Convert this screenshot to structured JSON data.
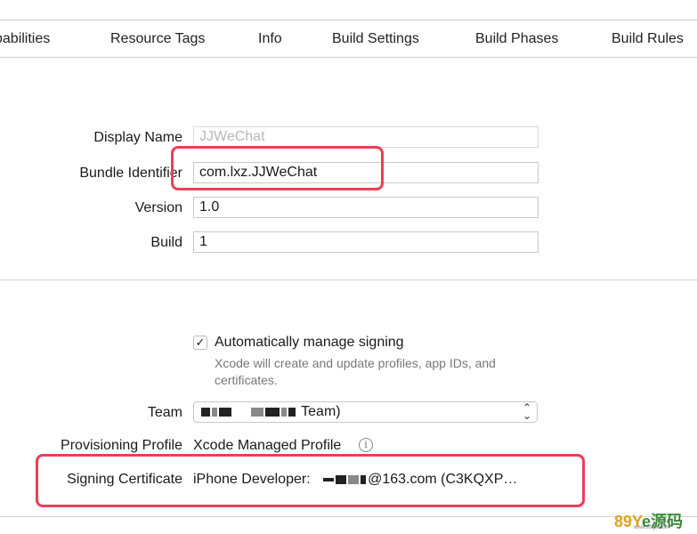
{
  "tabs": [
    {
      "label": "pabilities"
    },
    {
      "label": "Resource Tags"
    },
    {
      "label": "Info"
    },
    {
      "label": "Build Settings"
    },
    {
      "label": "Build Phases"
    },
    {
      "label": "Build Rules"
    }
  ],
  "identity": {
    "display_name_label": "Display Name",
    "display_name_placeholder": "JJWeChat",
    "bundle_id_label": "Bundle Identifier",
    "bundle_id_value": "com.lxz.JJWeChat",
    "version_label": "Version",
    "version_value": "1.0",
    "build_label": "Build",
    "build_value": "1"
  },
  "signing": {
    "auto_manage_label": "Automatically manage signing",
    "auto_manage_checked": true,
    "auto_manage_hint": "Xcode will create and update profiles, app IDs, and certificates.",
    "team_label": "Team",
    "team_value": "Team)",
    "provisioning_label": "Provisioning Profile",
    "provisioning_value": "Xcode Managed Profile",
    "certificate_label": "Signing Certificate",
    "certificate_prefix": "iPhone Developer:",
    "certificate_suffix": "@163.com (C3KQXP…"
  },
  "icons": {
    "checkbox_glyph": "✓",
    "info_glyph": "i",
    "chevron_up": "⌃",
    "chevron_down": "⌄"
  },
  "colors": {
    "highlight": "#e8405a"
  },
  "watermark": {
    "text_a": "89Y",
    "text_b": "e源码",
    "sub": "www.89ye.com"
  }
}
